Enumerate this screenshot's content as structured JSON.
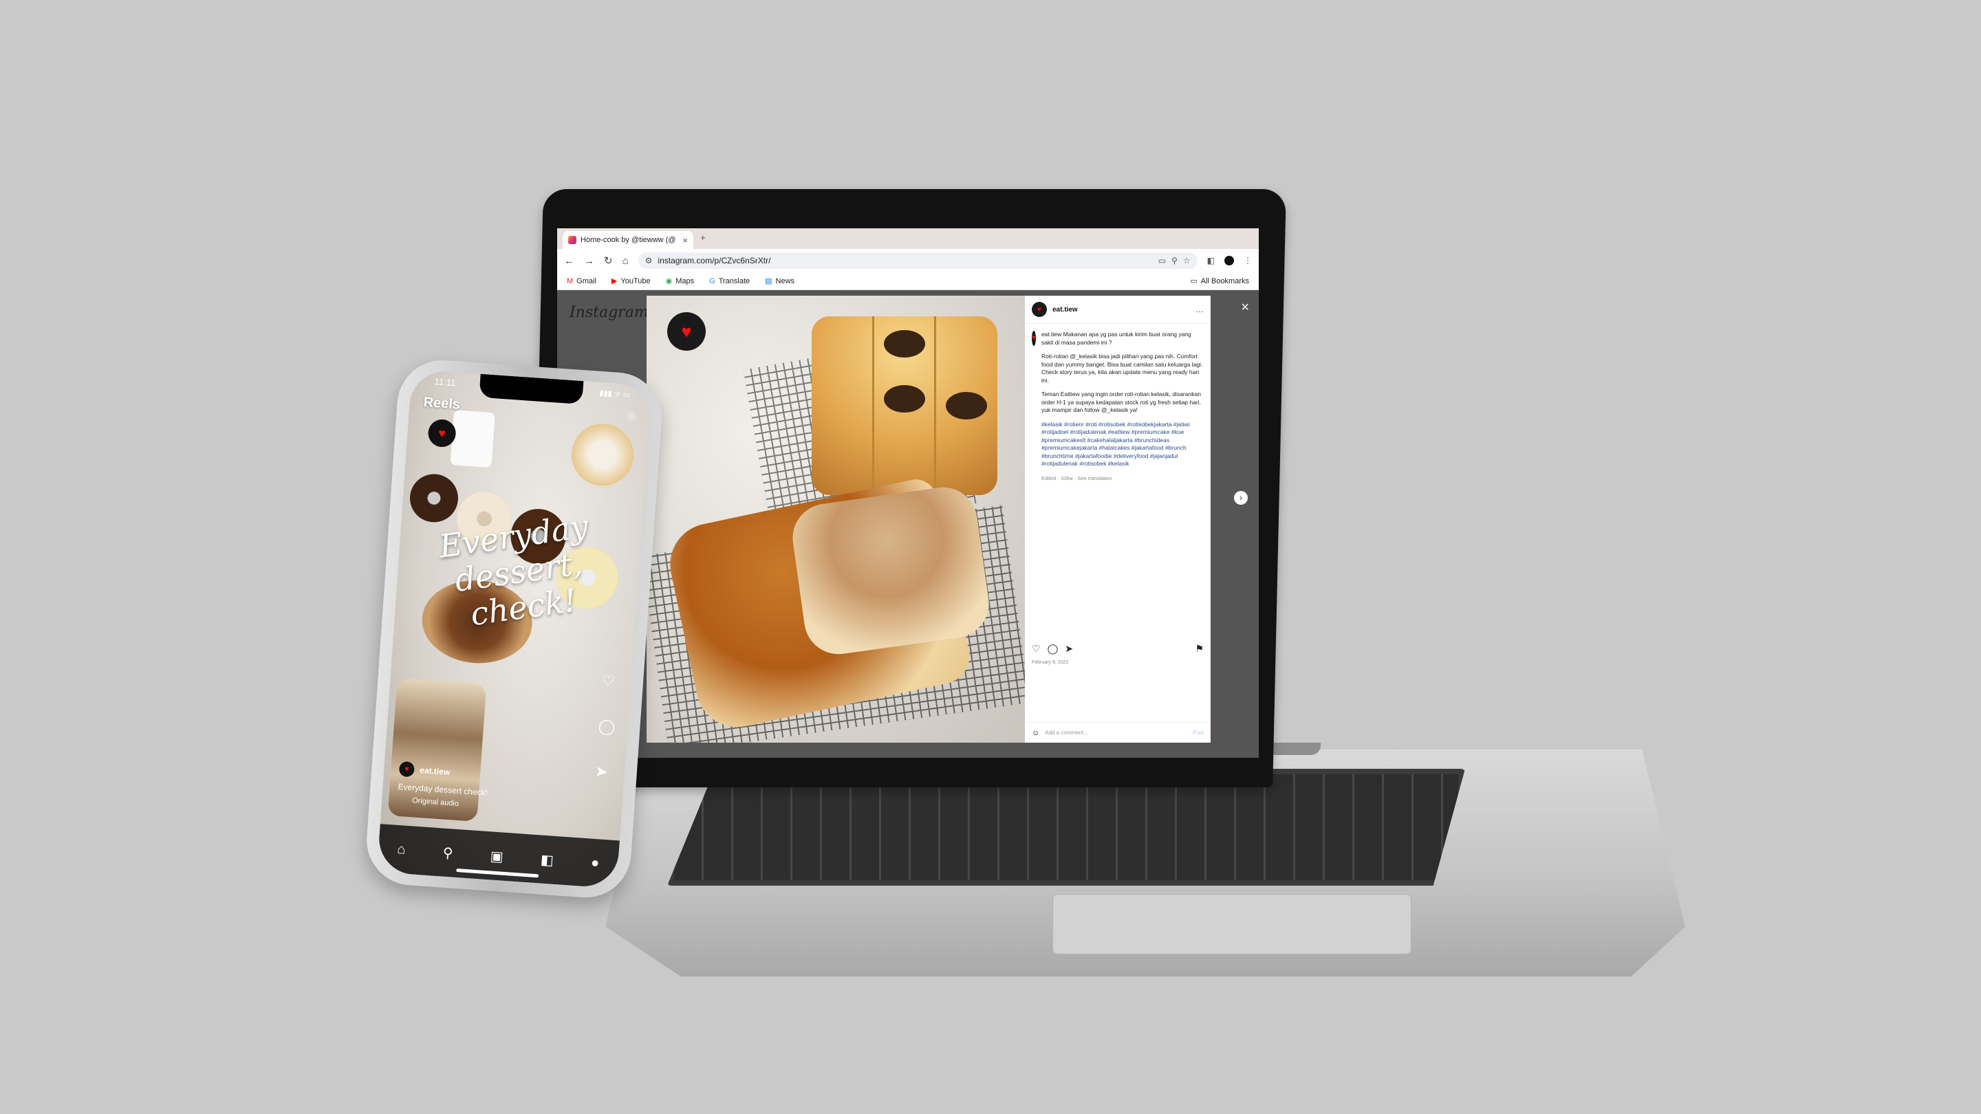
{
  "browser": {
    "tab_title": "Home-cook by @tiewww (@",
    "tab_close": "×",
    "new_tab": "+",
    "url": "instagram.com/p/CZvc6nSrXtr/",
    "nav": {
      "back": "←",
      "forward": "→",
      "reload": "↻",
      "home": "⌂"
    },
    "bookmarks": [
      {
        "label": "Gmail",
        "icon": "M"
      },
      {
        "label": "YouTube",
        "icon": "▶"
      },
      {
        "label": "Maps",
        "icon": "◉"
      },
      {
        "label": "Translate",
        "icon": "G"
      },
      {
        "label": "News",
        "icon": "▤"
      }
    ],
    "all_bookmarks": "All Bookmarks"
  },
  "instagram": {
    "logo": "Instagram",
    "close": "×",
    "next": "›",
    "username": "eat.tiew",
    "more": "…",
    "caption_intro": "eat.tiew Makanan apa yg pas untuk kirim buat orang yang sakit di masa pandemi ini ?",
    "caption_p1": "Roti-rotian @_kelasik bisa jadi pilihan yang pas nih. Comfort food dan yummy banget. Bisa buat camilan satu keluarga lagi. Check story terus ya, kita akan update menu yang ready hari ini.",
    "caption_p2": "Teman Eattiew yang ingin order roti-rotian kelasik, disarankan order H-1 ya supaya kedapatan stock roti yg fresh setiap hari, yuk mampir dan follow @_kelasik ya!",
    "hashtags": "#kelasik #rotienr #roti #rotisobek #rotisobekjakarta #jatiwi #rotijadoel #rotijadulenak #eattiew #premiumcake #kue #premiumcakeslt #cakehalaljakarta #brunchideas #premiumcakejakarta #halalcakes #jakartafood #brunch #brunchtime #jakartafoodie #deliveryfood #jajanjadul #rotijadulenak #rotisobek #kelasik",
    "meta": "Edited · 106w · See translation",
    "date": "February 9, 2022",
    "comment_placeholder": "Add a comment...",
    "post_button": "Post",
    "actions": {
      "like": "♡",
      "comment": "◯",
      "share": "➤",
      "save": "⚑"
    }
  },
  "phone": {
    "time": "11:11",
    "status": "▮▮▮ ᯤ ▭",
    "reels_label": "Reels",
    "camera": "⌾",
    "overlay_text_1": "Everyday",
    "overlay_text_2": "dessert,",
    "overlay_text_3": "check!",
    "username": "eat.tiew",
    "caption": "Everyday dessert check!",
    "audio": "Original audio",
    "side_actions": {
      "like": "♡",
      "comment": "◯",
      "share": "➤"
    },
    "nav": {
      "home": "⌂",
      "search": "⚲",
      "reels": "▣",
      "shop": "◧",
      "profile": "●"
    }
  }
}
